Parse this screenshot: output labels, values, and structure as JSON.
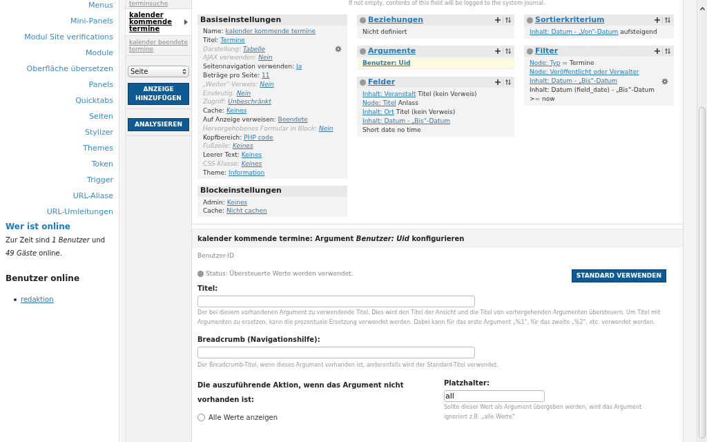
{
  "sidebar": {
    "links": [
      "Menus",
      "Mini-Panels",
      "Modul Site verifications",
      "Module",
      "Oberfläche übersetzen",
      "Panels",
      "Quicktabs",
      "Seiten",
      "Stylizer",
      "Themes",
      "Token",
      "Trigger",
      "URL-Aliase",
      "URL-Umleitungen"
    ],
    "who_online": {
      "title": "Wer ist online",
      "text": "Zur Zeit sind *1 Benutzer* und *49 Gäste* online."
    },
    "users_online": {
      "title": "Benutzer online",
      "users": [
        "redaktion"
      ]
    }
  },
  "view_tabs": {
    "tabs": [
      {
        "label": "terminsuche",
        "selected": false
      },
      {
        "label": "kalender kommende termine",
        "selected": true
      },
      {
        "label": "kalender beendete termine",
        "selected": false
      }
    ],
    "display_select": {
      "value": "Seite"
    },
    "buttons": [
      "ANZEIGE HINZUFÜGEN",
      "ANALYSIEREN"
    ]
  },
  "journal_note": "If not empty, contents of this field will be logged to the system journal.",
  "columns": [
    [
      {
        "kind": "settings",
        "title": "Basiseinstellungen",
        "rows": [
          {
            "label": "Name:",
            "value": "kalender kommende termine",
            "overridden": false,
            "gear": false
          },
          {
            "label": "Titel:",
            "value": "Termine",
            "overridden": false,
            "gear": false
          },
          {
            "label": "Darstellung:",
            "value": "Tabelle",
            "overridden": true,
            "gear": true
          },
          {
            "label": "AJAX verwenden:",
            "value": "Nein",
            "overridden": true,
            "gear": false
          },
          {
            "label": "Seitennavigation verwenden:",
            "value": "Ja",
            "overridden": false,
            "gear": false
          },
          {
            "label": "Beträge pro Seite:",
            "value": "11",
            "overridden": false,
            "gear": false
          },
          {
            "label": "„Weiter“-Verweis:",
            "value": "Nein",
            "overridden": true,
            "gear": false
          },
          {
            "label": "Eindeutig:",
            "value": "Nein",
            "overridden": true,
            "gear": false
          },
          {
            "label": "Zugriff:",
            "value": "Unbeschränkt",
            "overridden": true,
            "gear": false
          },
          {
            "label": "Cache:",
            "value": "Keines",
            "overridden": false,
            "gear": false
          },
          {
            "label": "Auf Anzeige verweisen:",
            "value": "Beendete",
            "overridden": false,
            "gear": false
          },
          {
            "label": "Hervorgehobenes Formular in Block:",
            "value": "Nein",
            "overridden": true,
            "gear": false
          },
          {
            "label": "Kopfbereich:",
            "value": "PHP code",
            "overridden": false,
            "gear": false
          },
          {
            "label": "Fußzeile:",
            "value": "Keines",
            "overridden": true,
            "gear": false
          },
          {
            "label": "Leerer Text:",
            "value": "Keines",
            "overridden": false,
            "gear": false
          },
          {
            "label": "CSS-Klasse:",
            "value": "Keines",
            "overridden": true,
            "gear": false
          },
          {
            "label": "Theme:",
            "value": "Information",
            "overridden": false,
            "gear": false
          }
        ]
      },
      {
        "kind": "settings",
        "title": "Blockeinstellungen",
        "rows": [
          {
            "label": "Admin:",
            "value": "Keines",
            "overridden": false,
            "gear": false
          },
          {
            "label": "Cache:",
            "value": "Nicht cachen",
            "overridden": false,
            "gear": false
          }
        ]
      }
    ],
    [
      {
        "kind": "list",
        "title": "Beziehungen",
        "rows": [
          {
            "link": "",
            "text": "Nicht definiert",
            "highlighted": false,
            "gear": false
          }
        ]
      },
      {
        "kind": "list",
        "title": "Argumente",
        "rows": [
          {
            "link": "Benutzer: Uid",
            "text": "",
            "highlighted": true,
            "gear": false
          }
        ]
      },
      {
        "kind": "list",
        "title": "Felder",
        "rows": [
          {
            "link": "Inhalt: Veranstalt",
            "text": "Titel (kein Verweis)",
            "highlighted": false,
            "gear": false
          },
          {
            "link": "Node: Titel",
            "text": "Anlass",
            "highlighted": false,
            "gear": false
          },
          {
            "link": "Inhalt: Ort",
            "text": "Titel (kein Verweis)",
            "highlighted": false,
            "gear": false
          },
          {
            "link": "Inhalt: Datum - „Bis“-Datum",
            "text": "Short date no time",
            "highlighted": false,
            "gear": false
          }
        ]
      }
    ],
    [
      {
        "kind": "list",
        "title": "Sortierkriterium",
        "rows": [
          {
            "link": "Inhalt: Datum - „Von“-Datum",
            "text": "aufsteigend",
            "highlighted": false,
            "gear": false
          }
        ]
      },
      {
        "kind": "list",
        "title": "Filter",
        "rows": [
          {
            "link": "Node: Typ",
            "text": "= Termine",
            "highlighted": false,
            "gear": false
          },
          {
            "link": "Node: Veröffentlicht oder Verwalter",
            "text": "",
            "highlighted": false,
            "gear": false
          },
          {
            "link": "Inhalt: Datum - „Bis“-Datum",
            "text": "Inhalt: Datum (field_date) - „Bis“-Datum >= now",
            "highlighted": false,
            "gear": true
          }
        ]
      }
    ]
  ],
  "config": {
    "title": "kalender kommende termine: Argument *Benutzer: Uid* konfigurieren",
    "subtitle": "Benutzer-ID",
    "status": "Status: Übersteuerte Werte werden verwendet.",
    "button": "STANDARD VERWENDEN",
    "title_field": {
      "label": "Titel:",
      "description": "Der bei diesem vorhandenen Argument zu verwendende Titel. Dies wird den Titel der Ansicht und die Titel von vorhergehenden Argumenten übersteuern. Um Titel mit Argumenten zu ersetzen, kann die prozentuale Ersetzung verwendet werden. Dabei kann für das erste Argument „%1“, für das zweite „%2“, etc. verwendet werden."
    },
    "breadcrumb_field": {
      "label": "Breadcrumb (Navigationshilfe):",
      "description": "Der Breadcrumb-Titel, wenn dieses Argument vorhanden ist, anderenfalls wird der Standard-Titel verwendet."
    },
    "action": {
      "label": "Die auszuführende Aktion, wenn das Argument nicht vorhanden ist:",
      "options": [
        {
          "label": "Alle Werte anzeigen",
          "selected": false
        }
      ]
    },
    "wildcard_field": {
      "label": "Platzhalter:",
      "value": "all",
      "description": "Sollte dieser Wert als Argument übergeben werden, wird das Argument ignoriert z.B. „alle Werte“"
    }
  }
}
